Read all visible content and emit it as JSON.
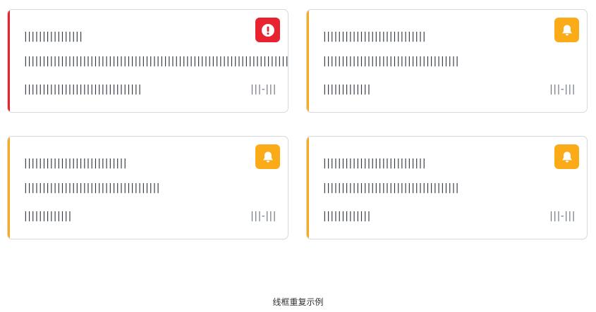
{
  "colors": {
    "error": "#e8222f",
    "warning": "#fbaa18",
    "border": "#d6d8dc",
    "text": "#333a44"
  },
  "cards": [
    {
      "type": "error",
      "icon": "exclamation-icon",
      "title": "||||||||||||||||",
      "message": "||||||||||||||||||||||||||||||||||||||||||||||||||||||||||||||||||||||||",
      "source": "||||||||||||||||||||||||||||||||",
      "time": "|||-|||"
    },
    {
      "type": "warning",
      "icon": "bell-icon",
      "title": "||||||||||||||||||||||||||||",
      "message": "|||||||||||||||||||||||||||||||||||||",
      "source": "|||||||||||||",
      "time": "|||-|||"
    },
    {
      "type": "warning",
      "icon": "bell-icon",
      "title": "||||||||||||||||||||||||||||",
      "message": "|||||||||||||||||||||||||||||||||||||",
      "source": "|||||||||||||",
      "time": "|||-|||"
    },
    {
      "type": "warning",
      "icon": "bell-icon",
      "title": "||||||||||||||||||||||||||||",
      "message": "|||||||||||||||||||||||||||||||||||||",
      "source": "|||||||||||||",
      "time": "|||-|||"
    }
  ],
  "caption": "线框重复示例"
}
